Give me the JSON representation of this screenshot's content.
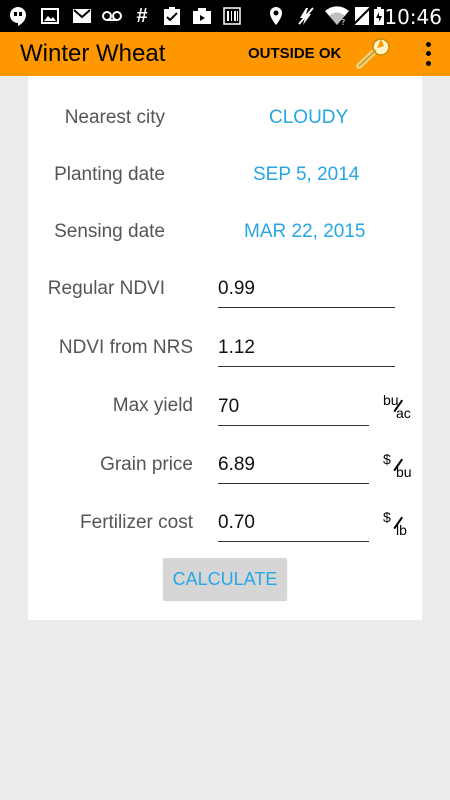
{
  "status_bar": {
    "time": "10:46",
    "icons": [
      "hangouts-icon",
      "image-icon",
      "gmail-icon",
      "voicemail-icon",
      "hash-icon",
      "clipboard-check-icon",
      "camera-icon",
      "barcode-icon",
      "location-icon",
      "no-signal-icon",
      "wifi-icon",
      "battery-icon"
    ]
  },
  "app_bar": {
    "title": "Winter Wheat",
    "status": "OUTSIDE OK",
    "wrench_icon": "wrench-icon",
    "overflow_icon": "more-vert-icon",
    "color": "#ff9800"
  },
  "form": {
    "nearest_city": {
      "label": "Nearest city",
      "value": "CLOUDY"
    },
    "planting_date": {
      "label": "Planting date",
      "value": "SEP 5, 2014"
    },
    "sensing_date": {
      "label": "Sensing date",
      "value": "MAR 22, 2015"
    },
    "regular_ndvi": {
      "label": "Regular NDVI",
      "value": "0.99"
    },
    "ndvi_nrs": {
      "label": "NDVI from NRS",
      "value": "1.12"
    },
    "max_yield": {
      "label": "Max yield",
      "value": "70",
      "unit_num": "bu",
      "unit_den": "ac"
    },
    "grain_price": {
      "label": "Grain price",
      "value": "6.89",
      "unit_num": "$",
      "unit_den": "bu"
    },
    "fertilizer_cost": {
      "label": "Fertilizer cost",
      "value": "0.70",
      "unit_num": "$",
      "unit_den": "lb"
    },
    "calculate_label": "CALCULATE"
  },
  "colors": {
    "accent": "#27a6e6",
    "app_bar": "#ff9800",
    "background": "#ececec"
  }
}
